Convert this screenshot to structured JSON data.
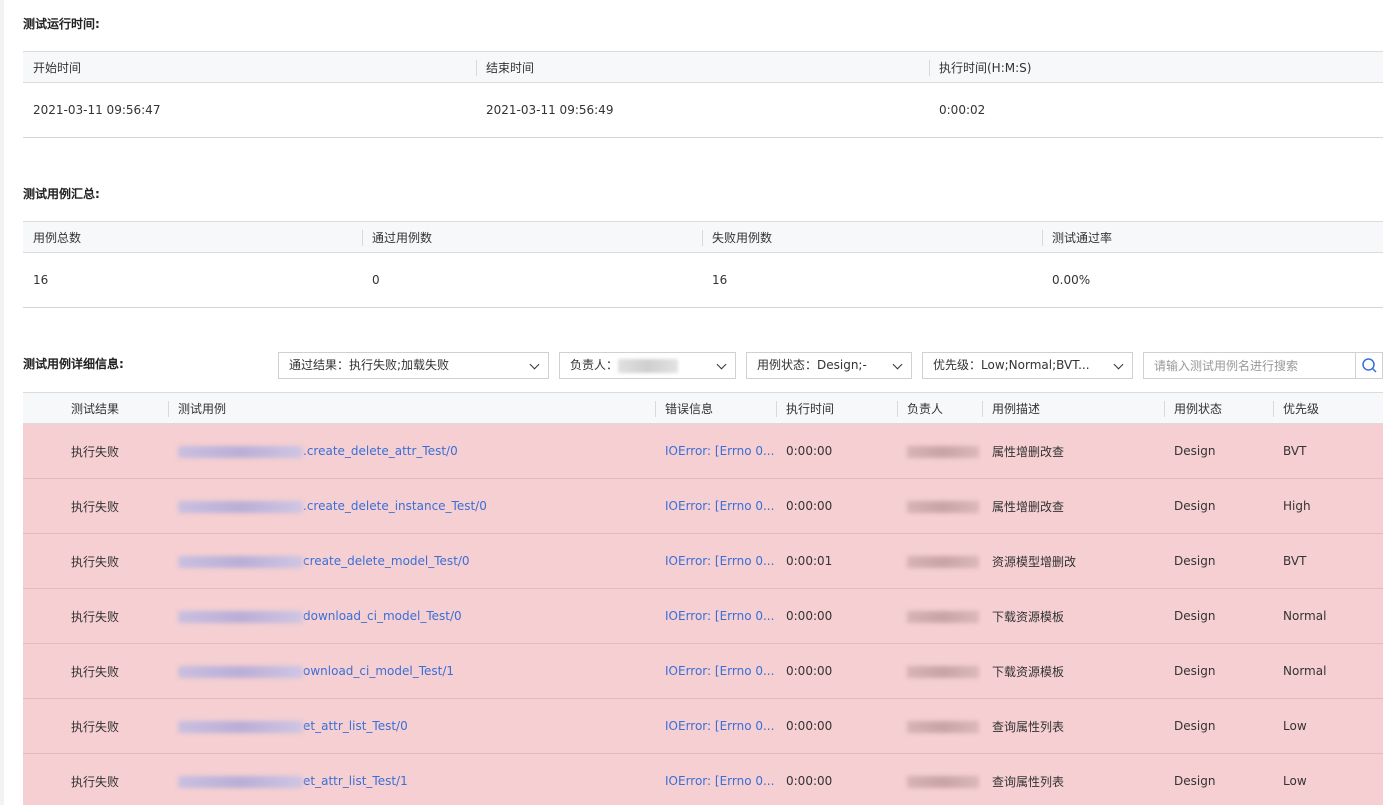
{
  "run_time": {
    "title": "测试运行时间:",
    "headers": [
      "开始时间",
      "结束时间",
      "执行时间(H:M:S)"
    ],
    "values": [
      "2021-03-11 09:56:47",
      "2021-03-11 09:56:49",
      "0:00:02"
    ]
  },
  "summary": {
    "title": "测试用例汇总:",
    "headers": [
      "用例总数",
      "通过用例数",
      "失败用例数",
      "测试通过率"
    ],
    "values": [
      "16",
      "0",
      "16",
      "0.00%"
    ]
  },
  "detail": {
    "title": "测试用例详细信息:",
    "filters": {
      "result": "通过结果：执行失败;加载失败",
      "owner": "负责人：",
      "status": "用例状态：Design;-",
      "priority": "优先级：Low;Normal;BVT..."
    },
    "search_placeholder": "请输入测试用例名进行搜索",
    "headers": [
      "测试结果",
      "测试用例",
      "错误信息",
      "执行时间",
      "负责人",
      "用例描述",
      "用例状态",
      "优先级"
    ],
    "rows": [
      {
        "result": "执行失败",
        "case": ".create_delete_attr_Test/0",
        "error": "IOError: [Errno 0...",
        "time": "0:00:00",
        "desc": "属性增删改查",
        "status": "Design",
        "priority": "BVT"
      },
      {
        "result": "执行失败",
        "case": ".create_delete_instance_Test/0",
        "error": "IOError: [Errno 0...",
        "time": "0:00:00",
        "desc": "属性增删改查",
        "status": "Design",
        "priority": "High"
      },
      {
        "result": "执行失败",
        "case": "create_delete_model_Test/0",
        "error": "IOError: [Errno 0...",
        "time": "0:00:01",
        "desc": "资源模型增删改",
        "status": "Design",
        "priority": "BVT"
      },
      {
        "result": "执行失败",
        "case": "download_ci_model_Test/0",
        "error": "IOError: [Errno 0...",
        "time": "0:00:00",
        "desc": "下载资源模板",
        "status": "Design",
        "priority": "Normal"
      },
      {
        "result": "执行失败",
        "case": "ownload_ci_model_Test/1",
        "error": "IOError: [Errno 0...",
        "time": "0:00:00",
        "desc": "下载资源模板",
        "status": "Design",
        "priority": "Normal"
      },
      {
        "result": "执行失败",
        "case": "et_attr_list_Test/0",
        "error": "IOError: [Errno 0...",
        "time": "0:00:00",
        "desc": "查询属性列表",
        "status": "Design",
        "priority": "Low"
      },
      {
        "result": "执行失败",
        "case": "et_attr_list_Test/1",
        "error": "IOError: [Errno 0...",
        "time": "0:00:00",
        "desc": "查询属性列表",
        "status": "Design",
        "priority": "Low"
      }
    ]
  },
  "colors": {
    "fail_row_bg": "#f5cfd1",
    "link": "#3a6fd8",
    "pass_count": "#2aa52a",
    "fail_count": "#e03a3a"
  }
}
